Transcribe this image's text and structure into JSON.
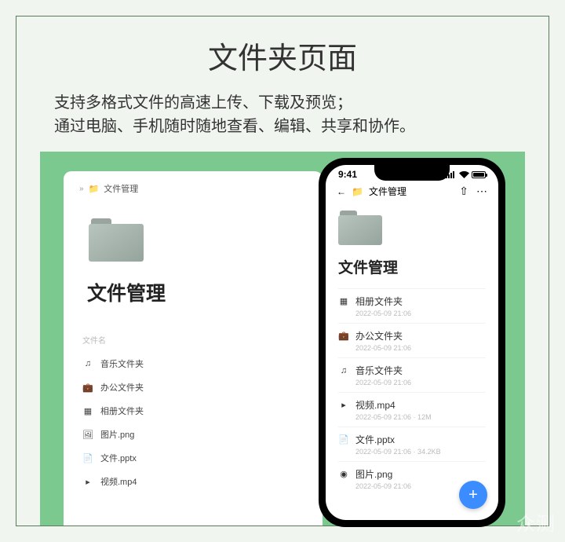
{
  "title": "文件夹页面",
  "desc_l1": "支持多格式文件的高速上传、下载及预览；",
  "desc_l2": "通过电脑、手机随时随地查看、编辑、共享和协作。",
  "desktop": {
    "breadcrumb": "文件管理",
    "heading": "文件管理",
    "col": "文件名",
    "rows": [
      {
        "icon": "♫",
        "name": "音乐文件夹"
      },
      {
        "icon": "💼",
        "name": "办公文件夹"
      },
      {
        "icon": "▦",
        "name": "相册文件夹"
      },
      {
        "icon": "🖼",
        "name": "图片.png"
      },
      {
        "icon": "📄",
        "name": "文件.pptx"
      },
      {
        "icon": "▸",
        "name": "视频.mp4"
      }
    ]
  },
  "phone": {
    "time": "9:41",
    "breadcrumb": "文件管理",
    "heading": "文件管理",
    "rows": [
      {
        "icon": "▦",
        "name": "相册文件夹",
        "sub": "2022-05-09 21:06"
      },
      {
        "icon": "💼",
        "name": "办公文件夹",
        "sub": "2022-05-09 21:06"
      },
      {
        "icon": "♫",
        "name": "音乐文件夹",
        "sub": "2022-05-09 21:06"
      },
      {
        "icon": "▸",
        "name": "视频.mp4",
        "sub": "2022-05-09 21:06 · 12M"
      },
      {
        "icon": "📄",
        "name": "文件.pptx",
        "sub": "2022-05-09 21:06 · 34.2KB"
      },
      {
        "icon": "◉",
        "name": "图片.png",
        "sub": "2022-05-09 21:06"
      }
    ]
  },
  "watermark": "众测"
}
